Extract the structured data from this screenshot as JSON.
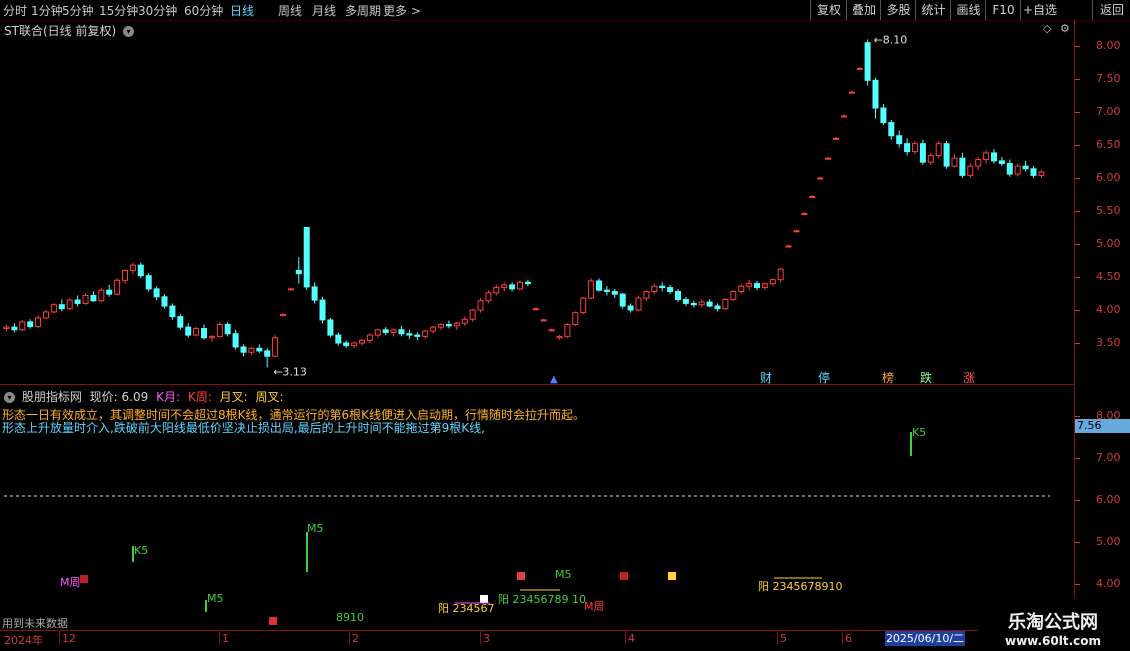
{
  "toolbar": {
    "periods": [
      "分时",
      "1分钟",
      "5分钟",
      "15分钟",
      "30分钟",
      "60分钟",
      "日线",
      "周线",
      "月线",
      "多周期",
      "更多 >"
    ],
    "active_index": 6,
    "right_buttons": [
      "复权",
      "叠加",
      "多股",
      "统计",
      "画线",
      "F10",
      "+自选",
      "返回"
    ]
  },
  "main": {
    "title": "ST联合(日线 前复权)",
    "y_labels": [
      "8.00",
      "7.50",
      "7.00",
      "6.50",
      "6.00",
      "5.50",
      "5.00",
      "4.50",
      "4.00",
      "3.50"
    ],
    "high_label": "8.10",
    "low_label": "3.13",
    "events": [
      "财",
      "停",
      "榜",
      "跌",
      "涨"
    ]
  },
  "indicator": {
    "name": "股朋指标网",
    "price_label": "现价: 6.09",
    "legend": [
      "K月:",
      "K周:",
      "月叉:",
      "周叉:"
    ],
    "desc_line1": "形态一日有效成立，其调整时间不会超过8根K线，通常运行的第6根K线便进入启动期，行情随时会拉升而起。",
    "desc_line2": "形态上升放量时介入,跌破前大阳线最低价坚决止损出局,最后的上升时间不能拖过第9根K线,",
    "y_labels": [
      "8.00",
      "7.00",
      "6.00",
      "5.00",
      "4.00"
    ],
    "current_value": "7.56",
    "markers": [
      {
        "text": "K5"
      },
      {
        "text": "M5"
      },
      {
        "text": "M周"
      },
      {
        "text": "M5"
      },
      {
        "text": "阳 234567"
      },
      {
        "text": "阳 23456789 10"
      },
      {
        "text": "M5"
      },
      {
        "text": "M周"
      },
      {
        "text": "K5"
      },
      {
        "text": "阳 2345678910"
      },
      {
        "text": "8910"
      },
      {
        "text": "用到未来数据"
      }
    ]
  },
  "xaxis": {
    "labels": [
      "2024年",
      "12",
      "1",
      "2",
      "3",
      "4",
      "5",
      "6"
    ],
    "cursor_date": "2025/06/10/二"
  },
  "watermark": {
    "line1": "乐淘公式网",
    "line2": "www.60lt.com"
  },
  "colors": {
    "up": "#ff3c3c",
    "down": "#54ffff",
    "axis": "#d23a3a"
  },
  "chart_data": {
    "type": "candlestick",
    "title": "ST联合(日线 前复权)",
    "ylim": [
      3.1,
      8.2
    ],
    "candles": [
      [
        3.72,
        3.78,
        3.68,
        3.74
      ],
      [
        3.74,
        3.8,
        3.66,
        3.7
      ],
      [
        3.7,
        3.85,
        3.68,
        3.82
      ],
      [
        3.82,
        3.86,
        3.72,
        3.75
      ],
      [
        3.75,
        3.92,
        3.73,
        3.88
      ],
      [
        3.88,
        4.0,
        3.86,
        3.97
      ],
      [
        3.97,
        4.1,
        3.95,
        4.08
      ],
      [
        4.08,
        4.16,
        3.98,
        4.02
      ],
      [
        4.02,
        4.18,
        4.0,
        4.15
      ],
      [
        4.15,
        4.22,
        4.05,
        4.1
      ],
      [
        4.1,
        4.25,
        4.08,
        4.22
      ],
      [
        4.22,
        4.28,
        4.12,
        4.14
      ],
      [
        4.14,
        4.34,
        4.12,
        4.3
      ],
      [
        4.3,
        4.38,
        4.2,
        4.24
      ],
      [
        4.24,
        4.48,
        4.22,
        4.45
      ],
      [
        4.45,
        4.62,
        4.4,
        4.6
      ],
      [
        4.6,
        4.72,
        4.55,
        4.68
      ],
      [
        4.68,
        4.72,
        4.48,
        4.52
      ],
      [
        4.52,
        4.56,
        4.28,
        4.32
      ],
      [
        4.32,
        4.36,
        4.15,
        4.2
      ],
      [
        4.2,
        4.24,
        4.02,
        4.06
      ],
      [
        4.06,
        4.1,
        3.85,
        3.9
      ],
      [
        3.9,
        3.94,
        3.7,
        3.74
      ],
      [
        3.74,
        3.8,
        3.58,
        3.62
      ],
      [
        3.62,
        3.75,
        3.6,
        3.72
      ],
      [
        3.72,
        3.78,
        3.55,
        3.58
      ],
      [
        3.58,
        3.62,
        3.52,
        3.6
      ],
      [
        3.6,
        3.82,
        3.58,
        3.78
      ],
      [
        3.78,
        3.82,
        3.6,
        3.64
      ],
      [
        3.64,
        3.7,
        3.4,
        3.44
      ],
      [
        3.44,
        3.48,
        3.3,
        3.36
      ],
      [
        3.36,
        3.44,
        3.32,
        3.42
      ],
      [
        3.42,
        3.48,
        3.35,
        3.38
      ],
      [
        3.38,
        3.42,
        3.13,
        3.3
      ],
      [
        3.3,
        3.62,
        3.28,
        3.58
      ],
      [
        3.93,
        3.95,
        3.92,
        3.93
      ],
      [
        4.32,
        4.34,
        4.3,
        4.32
      ],
      [
        4.6,
        4.8,
        4.4,
        4.55
      ],
      [
        5.25,
        5.25,
        4.3,
        4.35
      ],
      [
        4.35,
        4.42,
        4.1,
        4.15
      ],
      [
        4.15,
        4.2,
        3.8,
        3.85
      ],
      [
        3.85,
        3.88,
        3.58,
        3.62
      ],
      [
        3.62,
        3.66,
        3.46,
        3.5
      ],
      [
        3.5,
        3.54,
        3.42,
        3.46
      ],
      [
        3.46,
        3.52,
        3.42,
        3.5
      ],
      [
        3.5,
        3.56,
        3.46,
        3.54
      ],
      [
        3.54,
        3.64,
        3.5,
        3.62
      ],
      [
        3.62,
        3.72,
        3.58,
        3.7
      ],
      [
        3.7,
        3.74,
        3.62,
        3.66
      ],
      [
        3.66,
        3.72,
        3.6,
        3.7
      ],
      [
        3.7,
        3.76,
        3.6,
        3.64
      ],
      [
        3.64,
        3.7,
        3.56,
        3.62
      ],
      [
        3.62,
        3.66,
        3.54,
        3.6
      ],
      [
        3.6,
        3.7,
        3.56,
        3.68
      ],
      [
        3.68,
        3.76,
        3.64,
        3.74
      ],
      [
        3.74,
        3.8,
        3.7,
        3.78
      ],
      [
        3.78,
        3.84,
        3.72,
        3.76
      ],
      [
        3.76,
        3.82,
        3.7,
        3.8
      ],
      [
        3.8,
        3.9,
        3.76,
        3.86
      ],
      [
        3.86,
        4.02,
        3.82,
        4.0
      ],
      [
        4.0,
        4.18,
        3.96,
        4.14
      ],
      [
        4.14,
        4.3,
        4.1,
        4.26
      ],
      [
        4.26,
        4.38,
        4.22,
        4.34
      ],
      [
        4.34,
        4.42,
        4.28,
        4.38
      ],
      [
        4.38,
        4.42,
        4.28,
        4.32
      ],
      [
        4.32,
        4.45,
        4.3,
        4.42
      ],
      [
        4.42,
        4.46,
        4.36,
        4.4
      ],
      [
        4.02,
        4.04,
        4.0,
        4.02
      ],
      [
        3.85,
        3.87,
        3.83,
        3.85
      ],
      [
        3.7,
        3.72,
        3.68,
        3.7
      ],
      [
        3.58,
        3.62,
        3.55,
        3.6
      ],
      [
        3.6,
        3.8,
        3.58,
        3.78
      ],
      [
        3.78,
        3.98,
        3.76,
        3.96
      ],
      [
        3.96,
        4.2,
        3.94,
        4.18
      ],
      [
        4.18,
        4.48,
        4.16,
        4.44
      ],
      [
        4.44,
        4.48,
        4.28,
        4.3
      ],
      [
        4.3,
        4.36,
        4.22,
        4.28
      ],
      [
        4.28,
        4.32,
        4.18,
        4.24
      ],
      [
        4.24,
        4.26,
        4.02,
        4.06
      ],
      [
        4.06,
        4.1,
        3.96,
        4.0
      ],
      [
        4.0,
        4.22,
        3.98,
        4.18
      ],
      [
        4.18,
        4.3,
        4.14,
        4.28
      ],
      [
        4.28,
        4.4,
        4.24,
        4.36
      ],
      [
        4.36,
        4.42,
        4.28,
        4.34
      ],
      [
        4.34,
        4.38,
        4.24,
        4.28
      ],
      [
        4.28,
        4.32,
        4.12,
        4.16
      ],
      [
        4.16,
        4.2,
        4.06,
        4.1
      ],
      [
        4.1,
        4.14,
        4.04,
        4.08
      ],
      [
        4.08,
        4.16,
        4.04,
        4.12
      ],
      [
        4.12,
        4.16,
        4.04,
        4.06
      ],
      [
        4.06,
        4.1,
        3.98,
        4.02
      ],
      [
        4.02,
        4.18,
        4.0,
        4.16
      ],
      [
        4.16,
        4.3,
        4.14,
        4.28
      ],
      [
        4.28,
        4.4,
        4.24,
        4.36
      ],
      [
        4.36,
        4.46,
        4.3,
        4.4
      ],
      [
        4.4,
        4.44,
        4.3,
        4.34
      ],
      [
        4.34,
        4.42,
        4.3,
        4.4
      ],
      [
        4.4,
        4.48,
        4.36,
        4.46
      ],
      [
        4.46,
        4.64,
        4.42,
        4.62
      ],
      [
        4.97,
        4.99,
        4.95,
        4.97
      ],
      [
        5.2,
        5.22,
        5.18,
        5.2
      ],
      [
        5.46,
        5.48,
        5.44,
        5.46
      ],
      [
        5.72,
        5.74,
        5.7,
        5.72
      ],
      [
        6.0,
        6.02,
        5.98,
        6.0
      ],
      [
        6.3,
        6.32,
        6.28,
        6.3
      ],
      [
        6.6,
        6.62,
        6.58,
        6.6
      ],
      [
        6.94,
        6.96,
        6.92,
        6.94
      ],
      [
        7.3,
        7.32,
        7.28,
        7.3
      ],
      [
        7.66,
        7.68,
        7.64,
        7.66
      ],
      [
        8.05,
        8.1,
        7.4,
        7.48
      ],
      [
        7.48,
        7.52,
        6.9,
        7.06
      ],
      [
        7.06,
        7.12,
        6.8,
        6.84
      ],
      [
        6.84,
        6.88,
        6.58,
        6.64
      ],
      [
        6.64,
        6.72,
        6.46,
        6.52
      ],
      [
        6.52,
        6.6,
        6.34,
        6.4
      ],
      [
        6.4,
        6.56,
        6.36,
        6.52
      ],
      [
        6.52,
        6.58,
        6.2,
        6.24
      ],
      [
        6.24,
        6.38,
        6.2,
        6.34
      ],
      [
        6.34,
        6.56,
        6.3,
        6.52
      ],
      [
        6.52,
        6.56,
        6.14,
        6.18
      ],
      [
        6.18,
        6.36,
        6.16,
        6.3
      ],
      [
        6.3,
        6.38,
        6.0,
        6.04
      ],
      [
        6.04,
        6.22,
        6.0,
        6.18
      ],
      [
        6.18,
        6.32,
        6.12,
        6.28
      ],
      [
        6.28,
        6.42,
        6.22,
        6.38
      ],
      [
        6.38,
        6.44,
        6.22,
        6.26
      ],
      [
        6.26,
        6.32,
        6.18,
        6.22
      ],
      [
        6.22,
        6.28,
        6.02,
        6.06
      ],
      [
        6.06,
        6.22,
        6.02,
        6.18
      ],
      [
        6.18,
        6.26,
        6.1,
        6.14
      ],
      [
        6.14,
        6.18,
        6.0,
        6.04
      ],
      [
        6.04,
        6.12,
        6.0,
        6.09
      ]
    ]
  }
}
